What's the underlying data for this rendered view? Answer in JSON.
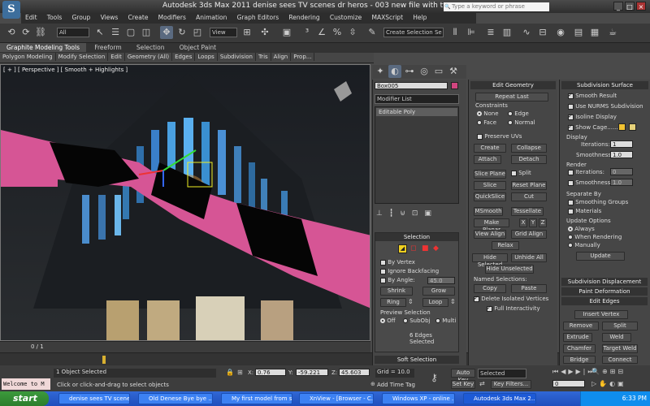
{
  "window": {
    "title": "Autodesk 3ds Max  2011    denise sees TV scenes dr heros - 003  new file with tv.max",
    "search_placeholder": "Type a keyword or phrase",
    "min": "_",
    "max": "□",
    "close": "×"
  },
  "menu": [
    "Edit",
    "Tools",
    "Group",
    "Views",
    "Create",
    "Modifiers",
    "Animation",
    "Graph Editors",
    "Rendering",
    "Customize",
    "MAXScript",
    "Help"
  ],
  "toolbar": {
    "filter_select": "All",
    "refcoord_select": "View",
    "selection_set": "Create Selection Se"
  },
  "ribbon": {
    "tabs": [
      "Graphite Modeling Tools",
      "Freeform",
      "Selection",
      "Object Paint"
    ],
    "active_tab": 0,
    "subtabs": [
      "Polygon Modeling",
      "Modify Selection",
      "Edit",
      "Geometry (All)",
      "Edges",
      "Loops",
      "Subdivision",
      "Tris",
      "Align",
      "Prop..."
    ]
  },
  "viewport": {
    "label": "[ + ] [ Perspective ] [ Smooth + Highlights ]",
    "frame": "0 / 1"
  },
  "command_panel": {
    "object_name": "Box005",
    "object_color": "#d1457f",
    "modifier_list": "Modifier List",
    "stack_item": "Editable Poly",
    "selection": {
      "title": "Selection",
      "by_vertex": "By Vertex",
      "ignore_backfacing": "Ignore Backfacing",
      "by_angle": "By Angle:",
      "angle_value": "45.0",
      "shrink": "Shrink",
      "grow": "Grow",
      "ring": "Ring",
      "loop": "Loop",
      "preview_title": "Preview Selection",
      "preview_off": "Off",
      "preview_subobj": "SubObj",
      "preview_multi": "Multi",
      "status": "6 Edges Selected"
    },
    "soft_selection": "Soft Selection"
  },
  "edit_geometry": {
    "title": "Edit Geometry",
    "repeat_last": "Repeat Last",
    "constraints": "Constraints",
    "c_none": "None",
    "c_edge": "Edge",
    "c_face": "Face",
    "c_normal": "Normal",
    "preserve_uvs": "Preserve UVs",
    "create": "Create",
    "collapse": "Collapse",
    "attach": "Attach",
    "detach": "Detach",
    "slice_plane": "Slice Plane",
    "split": "Split",
    "slice": "Slice",
    "reset_plane": "Reset Plane",
    "quickslice": "QuickSlice",
    "cut": "Cut",
    "msmooth": "MSmooth",
    "tessellate": "Tessellate",
    "make_planar": "Make Planar",
    "x": "X",
    "y": "Y",
    "z": "Z",
    "view_align": "View Align",
    "grid_align": "Grid Align",
    "relax": "Relax",
    "hide_selected": "Hide Selected",
    "unhide_all": "Unhide All",
    "hide_unselected": "Hide Unselected",
    "named_selections": "Named Selections:",
    "copy": "Copy",
    "paste": "Paste",
    "delete_isolated": "Delete Isolated Vertices",
    "full_interactivity": "Full Interactivity"
  },
  "subdivision": {
    "title": "Subdivision Surface",
    "smooth_result": "Smooth Result",
    "use_nurms": "Use NURMS Subdivision",
    "isoline": "Isoline Display",
    "show_cage": "Show Cage......",
    "cage_color1": "#f1c232",
    "cage_color2": "#e6d27a",
    "display": "Display",
    "iterations_label": "Iterations:",
    "iterations": "1",
    "smoothness_label": "Smoothness:",
    "smoothness": "1.0",
    "render": "Render",
    "r_iterations": "0",
    "r_smoothness": "1.0",
    "separate_by": "Separate By",
    "smoothing_groups": "Smoothing Groups",
    "materials": "Materials",
    "update_options": "Update Options",
    "always": "Always",
    "when_rendering": "When Rendering",
    "manually": "Manually",
    "update": "Update",
    "sub_displacement": "Subdivision Displacement",
    "paint_deformation": "Paint Deformation",
    "edit_edges": "Edit Edges",
    "insert_vertex": "Insert Vertex",
    "remove": "Remove",
    "split": "Split",
    "extrude": "Extrude",
    "weld": "Weld",
    "chamfer": "Chamfer",
    "target_weld": "Target Weld",
    "bridge": "Bridge",
    "connect": "Connect"
  },
  "status": {
    "maxscript": "Welcome to M",
    "selected": "1 Object Selected",
    "prompt": "Click or click-and-drag to select objects",
    "x_label": "X:",
    "x": "0.76",
    "y_label": "Y:",
    "y": "-59.221",
    "z_label": "Z:",
    "z": "45.603",
    "grid": "Grid = 10.0",
    "add_time_tag": "Add Time Tag",
    "auto_key": "Auto Key",
    "set_key": "Set Key",
    "key_select": "Selected",
    "key_filters": "Key Filters...",
    "frame": "0"
  },
  "taskbar": {
    "start": "start",
    "tasks": [
      "denise sees TV scene...",
      "Old Denese Bye bye ...",
      "My first model from s...",
      "XnView - [Browser - C...",
      "Windows XP - online ...",
      "Autodesk 3ds Max 2..."
    ],
    "clock": "6:33 PM"
  }
}
